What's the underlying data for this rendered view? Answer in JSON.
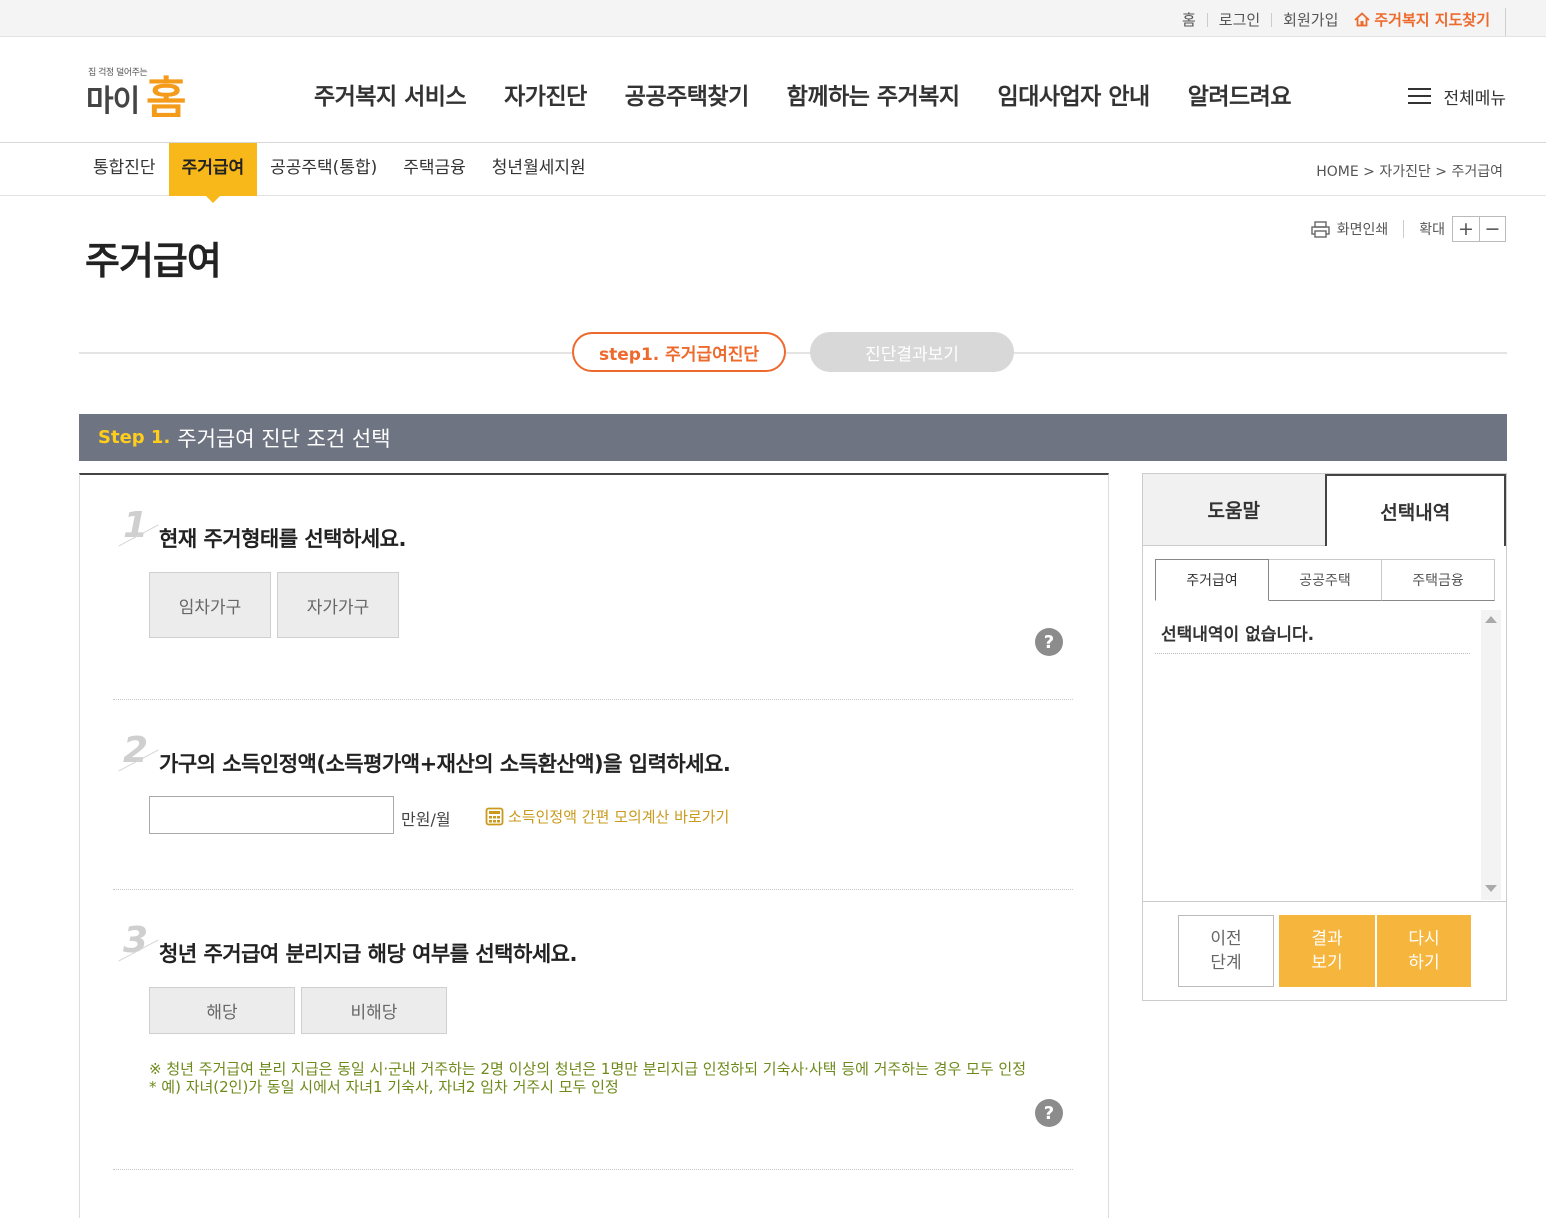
{
  "util": {
    "links": [
      "홈",
      "로그인",
      "회원가입"
    ],
    "map_link": "주거복지 지도찾기"
  },
  "logo": {
    "tagline": "집 걱정 덜어주는",
    "text_left": "마이",
    "text_right": "홈"
  },
  "gnb": [
    "주거복지 서비스",
    "자가진단",
    "공공주택찾기",
    "함께하는 주거복지",
    "임대사업자 안내",
    "알려드려요"
  ],
  "gnb_active": "자가진단",
  "all_menu": "전체메뉴",
  "subnav": [
    "통합진단",
    "주거급여",
    "공공주택(통합)",
    "주택금융",
    "청년월세지원"
  ],
  "subnav_active": "주거급여",
  "breadcrumb": "HOME > 자가진단 > 주거급여",
  "tools": {
    "print": "화면인쇄",
    "zoom": "확대",
    "plus": "+",
    "minus": "−"
  },
  "page_title": "주거급여",
  "steps": {
    "step1": "step1. 주거급여진단",
    "step2": "진단결과보기"
  },
  "stepbar": {
    "num": "Step 1.",
    "title": "주거급여 진단 조건 선택"
  },
  "q1": {
    "num": "1",
    "title": "현재 주거형태를 선택하세요.",
    "options": [
      "임차가구",
      "자가가구"
    ]
  },
  "q2": {
    "num": "2",
    "title": "가구의 소득인정액(소득평가액+재산의 소득환산액)을 입력하세요.",
    "input_value": "",
    "unit": "만원/월",
    "calc_link": "소득인정액 간편 모의계산 바로가기"
  },
  "q3": {
    "num": "3",
    "title": "청년 주거급여 분리지급 해당 여부를 선택하세요.",
    "options": [
      "해당",
      "비해당"
    ],
    "notice1": "※ 청년 주거급여 분리 지급은 동일 시·군내 거주하는 2명 이상의 청년은 1명만 분리지급 인정하되 기숙사·사택 등에 거주하는 경우 모두 인정",
    "notice2": "* 예) 자녀(2인)가 동일 시에서 자녀1 기숙사, 자녀2 임차 거주시 모두 인정"
  },
  "help_mark": "?",
  "right": {
    "tabs": [
      "도움말",
      "선택내역"
    ],
    "active_tab": "선택내역",
    "subtabs": [
      "주거급여",
      "공공주택",
      "주택금융"
    ],
    "active_subtab": "주거급여",
    "empty_text": "선택내역이 없습니다.",
    "buttons": {
      "prev": "이전\n단계",
      "result": "결과\n보기",
      "retry": "다시\n하기"
    }
  },
  "colors": {
    "accent": "#f9b81a",
    "orange": "#ee6a2c",
    "stepbar": "#6f7482",
    "button": "#f6b53c"
  }
}
